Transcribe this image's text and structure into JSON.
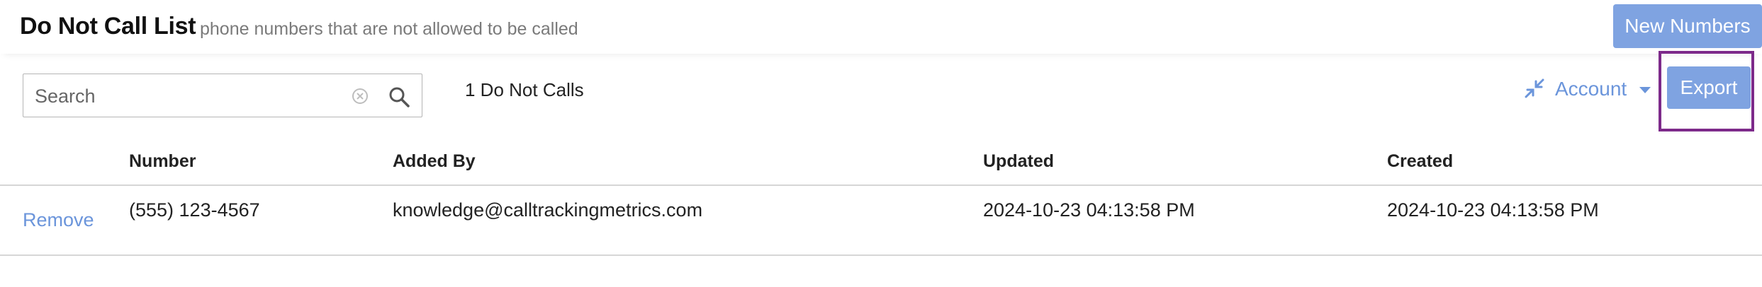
{
  "header": {
    "title": "Do Not Call List",
    "subtitle": "phone numbers that are not allowed to be called",
    "new_numbers_label": "New Numbers"
  },
  "toolbar": {
    "search_placeholder": "Search",
    "count_text": "1 Do Not Calls",
    "account_label": "Account",
    "export_label": "Export",
    "icons": [
      "clear-icon",
      "search-icon",
      "collapse-icon",
      "caret-down-icon"
    ]
  },
  "table": {
    "columns": [
      "Number",
      "Added By",
      "Updated",
      "Created"
    ],
    "rows": [
      {
        "action": "Remove",
        "number": "(555) 123-4567",
        "added_by": "knowledge@calltrackingmetrics.com",
        "updated": "2024-10-23 04:13:58 PM",
        "created": "2024-10-23 04:13:58 PM"
      }
    ]
  },
  "colors": {
    "accent": "#7fa3e1",
    "link": "#6b95db",
    "highlight": "#7d2a8a"
  }
}
